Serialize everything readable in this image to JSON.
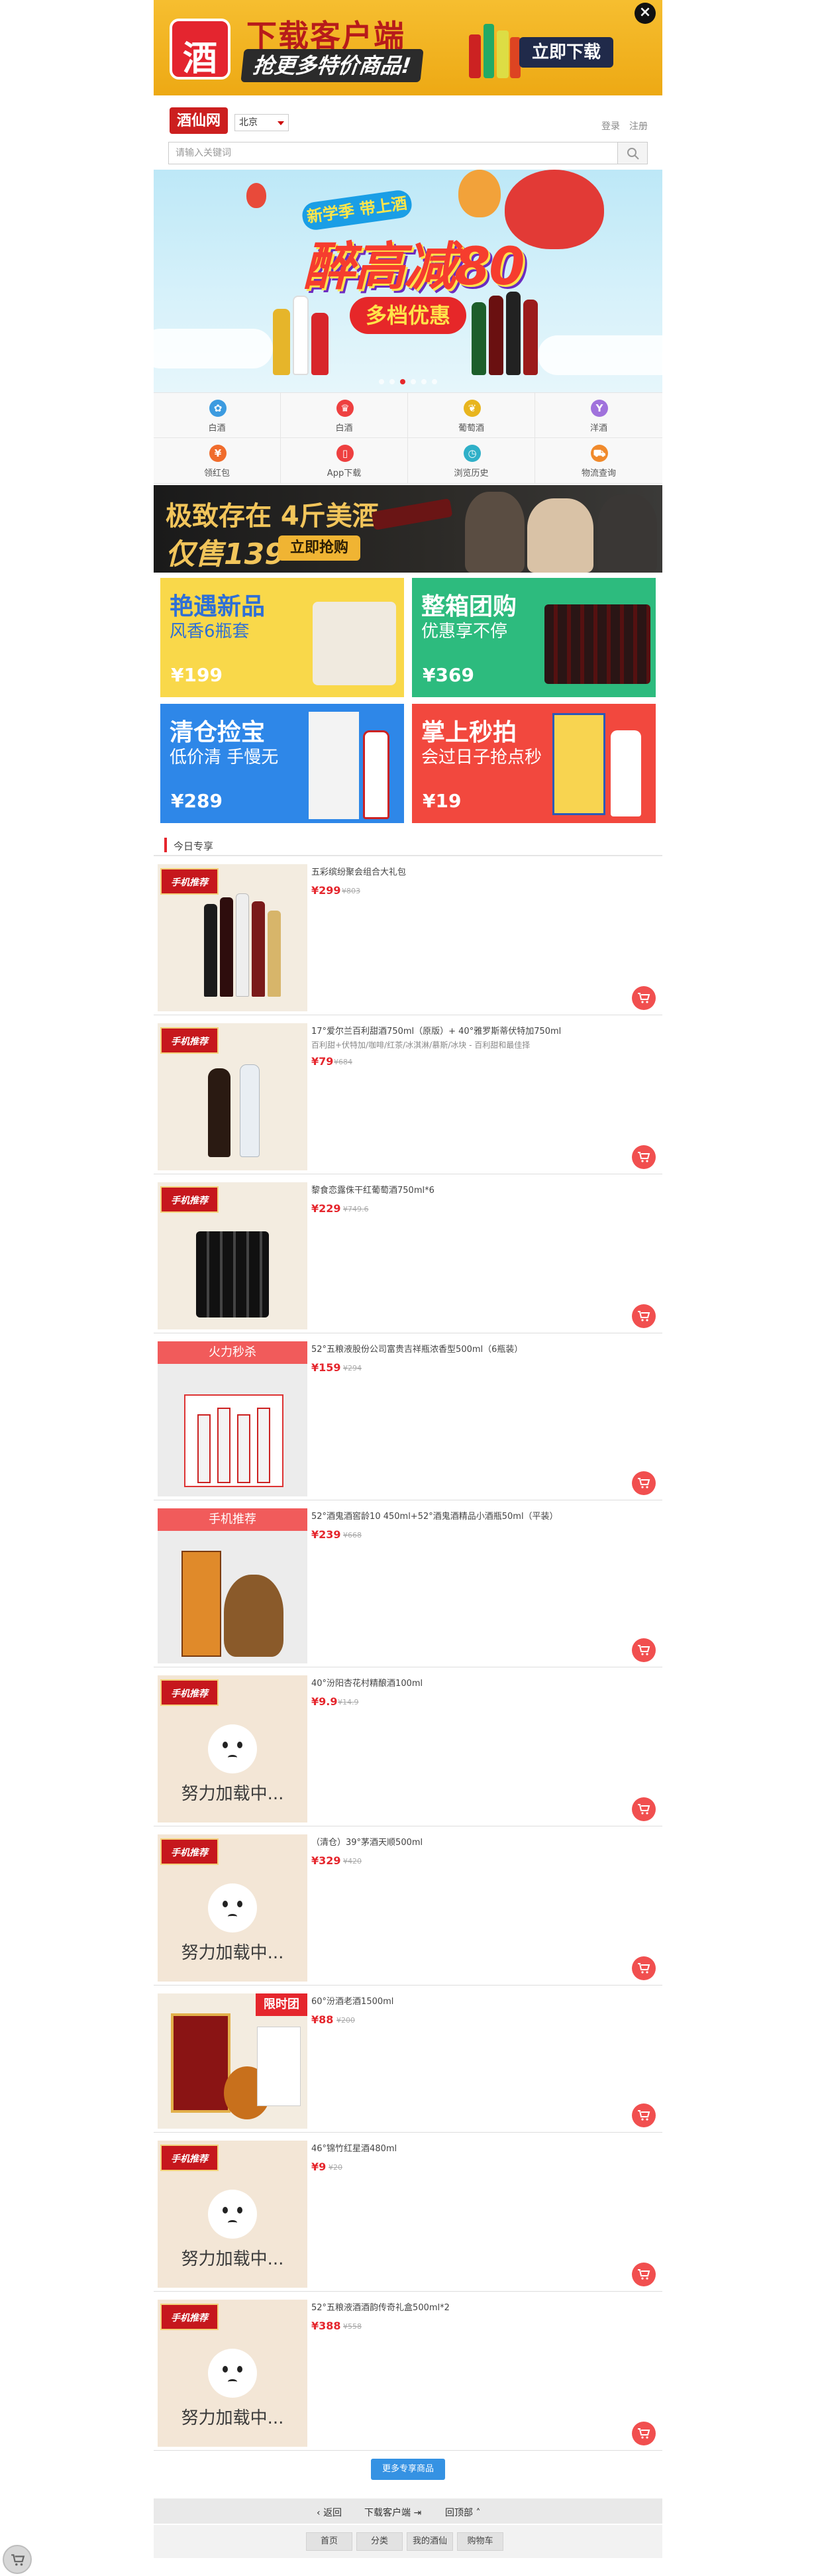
{
  "download_banner": {
    "title": "下载客户端",
    "subtitle": "抢更多特价商品!",
    "button": "立即下载",
    "logo_char": "酒",
    "close": "×"
  },
  "header": {
    "logo": "酒仙网",
    "city": "北京",
    "login": "登录",
    "register": "注册",
    "search_placeholder": "请输入关键词"
  },
  "hero": {
    "tag": "新学季 带上酒",
    "title": "醉高减80",
    "badge": "多档优惠"
  },
  "categories": [
    {
      "label": "白酒",
      "icon": "baijiu-icon",
      "color": "#3c9be0",
      "glyph": "✿"
    },
    {
      "label": "白酒",
      "icon": "wine-glass-icon",
      "color": "#ee4040",
      "glyph": "♛"
    },
    {
      "label": "葡萄酒",
      "icon": "grape-icon",
      "color": "#e8b51e",
      "glyph": "❦"
    },
    {
      "label": "洋酒",
      "icon": "cocktail-icon",
      "color": "#a072dc",
      "glyph": "Y"
    },
    {
      "label": "领红包",
      "icon": "red-packet-icon",
      "color": "#f06c2c",
      "glyph": "¥"
    },
    {
      "label": "App下载",
      "icon": "phone-icon",
      "color": "#ee4040",
      "glyph": "▯"
    },
    {
      "label": "浏览历史",
      "icon": "clock-icon",
      "color": "#2fb0c8",
      "glyph": "◷"
    },
    {
      "label": "物流查询",
      "icon": "truck-icon",
      "color": "#f08a2c",
      "glyph": "⛟"
    }
  ],
  "promo": {
    "line1": "极致存在 4斤美酒",
    "line2": "仅售139",
    "button": "立即抢购"
  },
  "tiles": [
    {
      "title": "艳遇新品",
      "subtitle": "风香6瓶套",
      "price": "¥199",
      "bg": "#f9d84a",
      "title_color": "#2e6fd6",
      "sub_color": "#2e6fd6"
    },
    {
      "title": "整箱团购",
      "subtitle": "优惠享不停",
      "price": "¥369",
      "bg": "#2dbb7e",
      "title_color": "#ffffff",
      "sub_color": "#ffffff"
    },
    {
      "title": "清仓捡宝",
      "subtitle": "低价清 手慢无",
      "price": "¥289",
      "bg": "#2e87e8",
      "title_color": "#ffffff",
      "sub_color": "#ffffff"
    },
    {
      "title": "掌上秒拍",
      "subtitle": "会过日子抢点秒",
      "price": "¥19",
      "bg": "#f2483e",
      "title_color": "#ffffff",
      "sub_color": "#ffffff"
    }
  ],
  "section_title": "今日专享",
  "badges": {
    "mobile_rec": "手机推荐",
    "fire_sale": "火力秒杀",
    "mobile_rec_b": "手机推荐",
    "limited_group": "限时团",
    "loading": "努力加载中..."
  },
  "products": [
    {
      "title": "五彩缤纷聚会组合大礼包",
      "subtitle": "",
      "price": "¥299",
      "old": "¥803"
    },
    {
      "title": "17°爱尔兰百利甜酒750ml（原版）+ 40°雅罗斯蒂伏特加750ml",
      "subtitle": "百利甜+伏特加/咖啡/红茶/冰淇淋/慕斯/冰块 - 百利甜和最佳择",
      "price": "¥79",
      "old": "¥684"
    },
    {
      "title": "黎食恋露侏干红葡萄酒750ml*6",
      "subtitle": "",
      "price": "¥229",
      "old": "¥749.6"
    },
    {
      "title": "52°五粮液股份公司富贵吉祥瓶浓香型500ml（6瓶装）",
      "subtitle": "",
      "price": "¥159",
      "old": "¥294"
    },
    {
      "title": "52°酒鬼酒窖龄10 450ml+52°酒鬼酒精品小酒瓶50ml（平装）",
      "subtitle": "",
      "price": "¥239",
      "old": "¥668"
    },
    {
      "title": "40°汾阳杏花村精酿酒100ml",
      "subtitle": "",
      "price": "¥9.9",
      "old": "¥14.9"
    },
    {
      "title": "（清仓）39°茅酒天顺500ml",
      "subtitle": "",
      "price": "¥329",
      "old": "¥420"
    },
    {
      "title": "60°汾酒老酒1500ml",
      "subtitle": "",
      "price": "¥88",
      "old": "¥200"
    },
    {
      "title": "46°锦竹红星酒480ml",
      "subtitle": "",
      "price": "¥9",
      "old": "¥20"
    },
    {
      "title": "52°五粮液酒酒韵传奇礼盒500ml*2",
      "subtitle": "",
      "price": "¥388",
      "old": "¥558"
    }
  ],
  "more_button": "更多专享商品",
  "footer": {
    "back": "返回",
    "download": "下载客户端",
    "top": "回顶部"
  },
  "bottom_nav": [
    "首页",
    "分类",
    "我的酒仙",
    "购物车"
  ],
  "colors": {
    "accent": "#e5262d",
    "link": "#3592e3"
  }
}
